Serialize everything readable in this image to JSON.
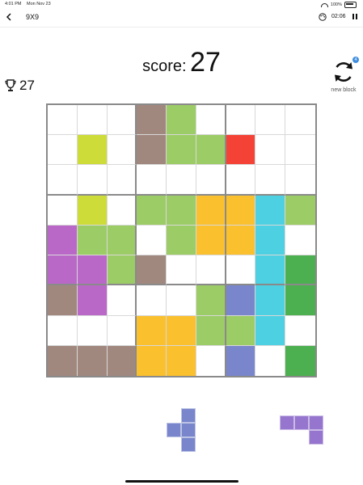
{
  "status_bar": {
    "time": "4:01 PM",
    "date": "Mon Nov 23",
    "battery": "100%"
  },
  "nav": {
    "title": "9X9",
    "timer": "02:06"
  },
  "score": {
    "label": "score:",
    "value": "27"
  },
  "best_score": "27",
  "new_block": {
    "label": "new block",
    "count": "4"
  },
  "colors": {
    "B": "#a1887f",
    "G": "#9ccc65",
    "Y": "#cddc39",
    "R": "#f44336",
    "O": "#fbc02d",
    "C": "#4dd0e1",
    "P": "#ba68c8",
    "I": "#7986cb",
    "D": "#4caf50"
  },
  "board": [
    "...BG....",
    ".Y.BGGR..",
    ".........",
    ".Y.GGOOCG",
    "PGG.GOOC.",
    "PPGB...CD",
    "BP...GICD",
    "...OOGGC.",
    "BBBOO.I.D"
  ],
  "pieces": [
    {
      "name": "piece-1",
      "color": "#7986cb",
      "cells": [
        ".X",
        "XX",
        ".X"
      ]
    },
    {
      "name": "piece-2",
      "color": "#9575cd",
      "cells": [
        "XXX",
        "..X"
      ]
    }
  ]
}
